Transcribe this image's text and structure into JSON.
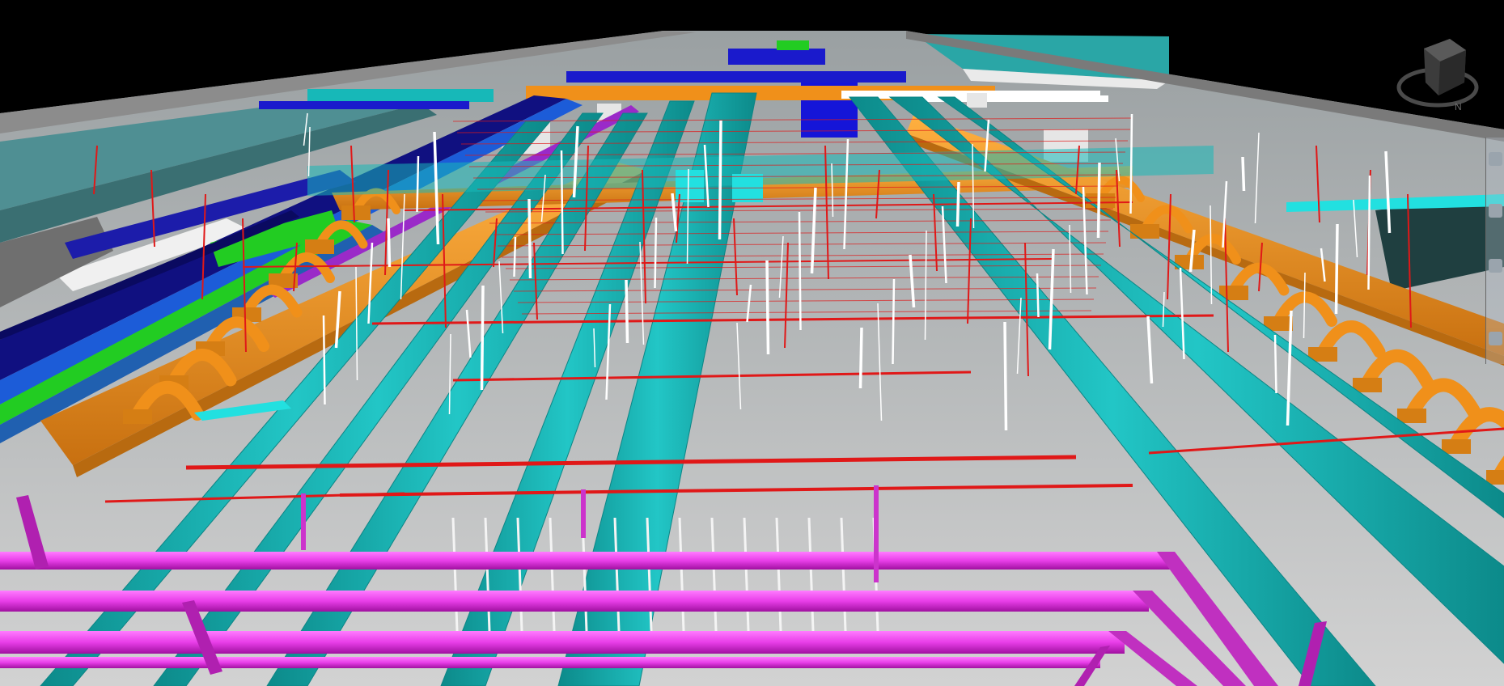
{
  "viewer": {
    "background": "#000000",
    "floor_color": "#c4c4c4",
    "colors": {
      "cyan_duct": "#17b8b8",
      "cyan_dark": "#0c8585",
      "orange_duct": "#f0901a",
      "orange_dark": "#b86a10",
      "magenta_pipe": "#e83ee8",
      "purple_pipe": "#8a2be2",
      "red_pipe": "#e01818",
      "white_pipe": "#ffffff",
      "blue_duct": "#1a1acc",
      "navy_duct": "#101080",
      "green_band": "#22cc22"
    }
  },
  "viewcube": {
    "compass": {
      "north": "N"
    }
  },
  "side_toolbar": {
    "buttons": [
      "orbit-icon",
      "pan-icon",
      "zoom-icon",
      "select-icon"
    ]
  }
}
